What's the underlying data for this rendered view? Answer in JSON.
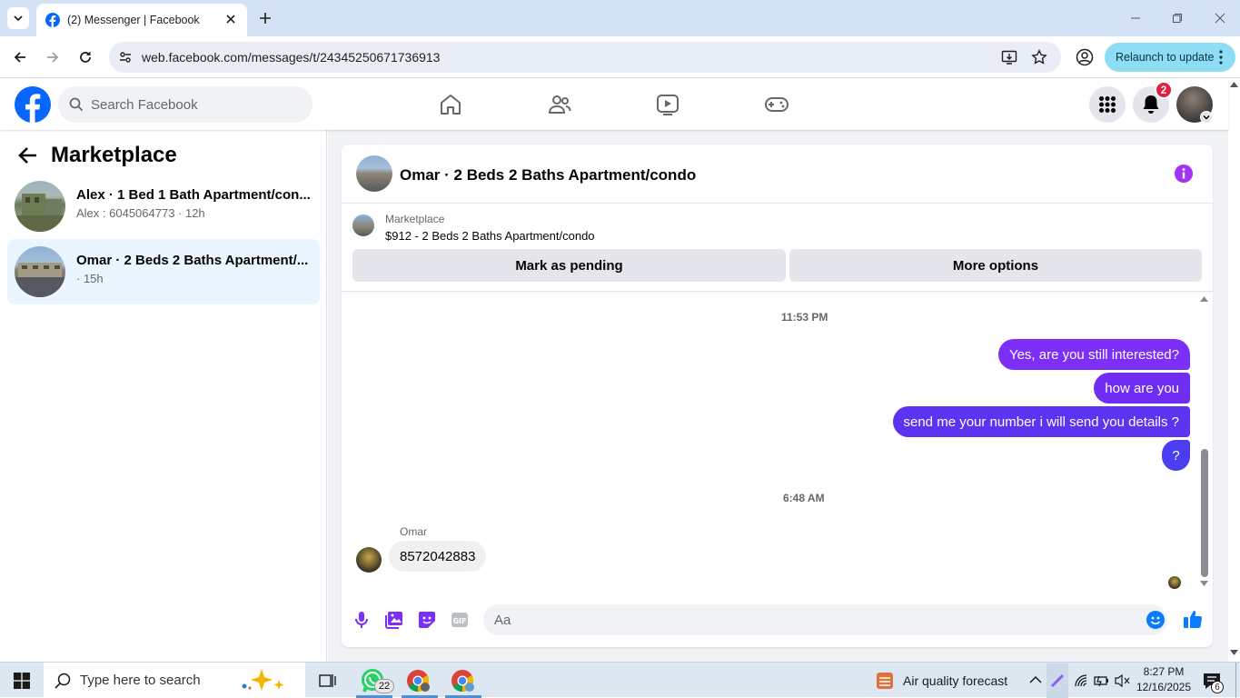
{
  "browser": {
    "tab_title": "(2) Messenger | Facebook",
    "url": "web.facebook.com/messages/t/24345250671736913",
    "relaunch_label": "Relaunch to update"
  },
  "fb": {
    "search_placeholder": "Search Facebook",
    "notification_count": "2",
    "brand_color": "#0866ff"
  },
  "sidebar": {
    "title": "Marketplace",
    "conversations": [
      {
        "title": "Alex · 1 Bed 1 Bath Apartment/con...",
        "subtitle": "Alex : 6045064773 · 12h",
        "selected": false
      },
      {
        "title": "Omar · 2 Beds 2 Baths Apartment/...",
        "subtitle": "· 15h",
        "selected": true
      }
    ]
  },
  "chat": {
    "header_title": "Omar · 2 Beds 2 Baths Apartment/condo",
    "listing_source": "Marketplace",
    "listing_title": "$912 - 2 Beds 2 Baths Apartment/condo",
    "mark_pending_label": "Mark as pending",
    "more_options_label": "More options",
    "timestamp_1": "11:53 PM",
    "timestamp_2": "6:48 AM",
    "outgoing": [
      "Yes, are you still interested?",
      "how are you",
      "send me your number i will send you details ?",
      "?"
    ],
    "incoming_sender": "Omar",
    "incoming_message": "8572042883",
    "composer_placeholder": "Aa",
    "accent_color": "#7b2ff7"
  },
  "taskbar": {
    "search_placeholder": "Type here to search",
    "whatsapp_badge": "22",
    "weather_label": "Air quality forecast",
    "time": "8:27 PM",
    "date": "12/16/2025",
    "notification_count": "6"
  }
}
